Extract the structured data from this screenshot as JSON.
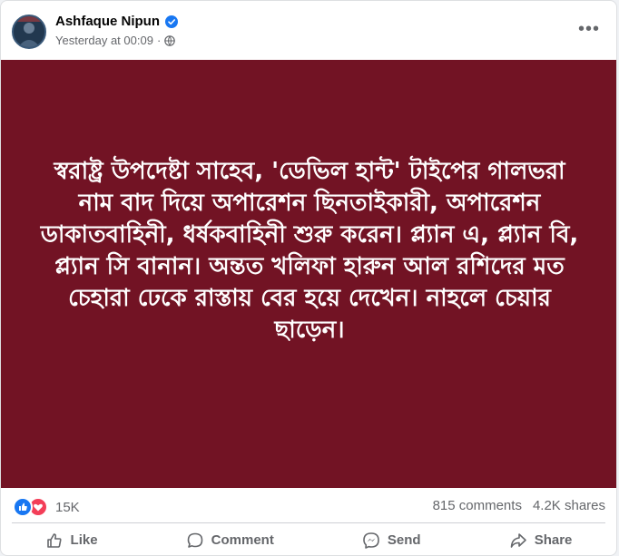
{
  "post": {
    "author": "Ashfaque Nipun",
    "timestamp": "Yesterday at 00:09",
    "separator": "·",
    "audience_icon": "globe-icon",
    "more_label": "•••",
    "text": "স্বরাষ্ট্র উপদেষ্টা সাহেব, 'ডেভিল হান্ট' টাইপের গালভরা নাম বাদ দিয়ে অপারেশন ছিনতাইকারী, অপারেশন ডাকাতবাহিনী, ধর্ষকবাহিনী শুরু করেন। প্ল্যান এ, প্ল্যান বি, প্ল্যান সি বানান। অন্তত খলিফা হারুন আল রশিদের মত চেহারা ঢেকে রাস্তায় বের হয়ে দেখেন। নাহলে চেয়ার ছাড়েন।",
    "background_color": "#721324"
  },
  "stats": {
    "reactions_count": "15K",
    "comments": "815 comments",
    "shares": "4.2K shares"
  },
  "actions": {
    "like": "Like",
    "comment": "Comment",
    "send": "Send",
    "share": "Share"
  },
  "colors": {
    "verified": "#1877f2",
    "like_reaction": "#1877f2",
    "love_reaction": "#f33e58"
  }
}
